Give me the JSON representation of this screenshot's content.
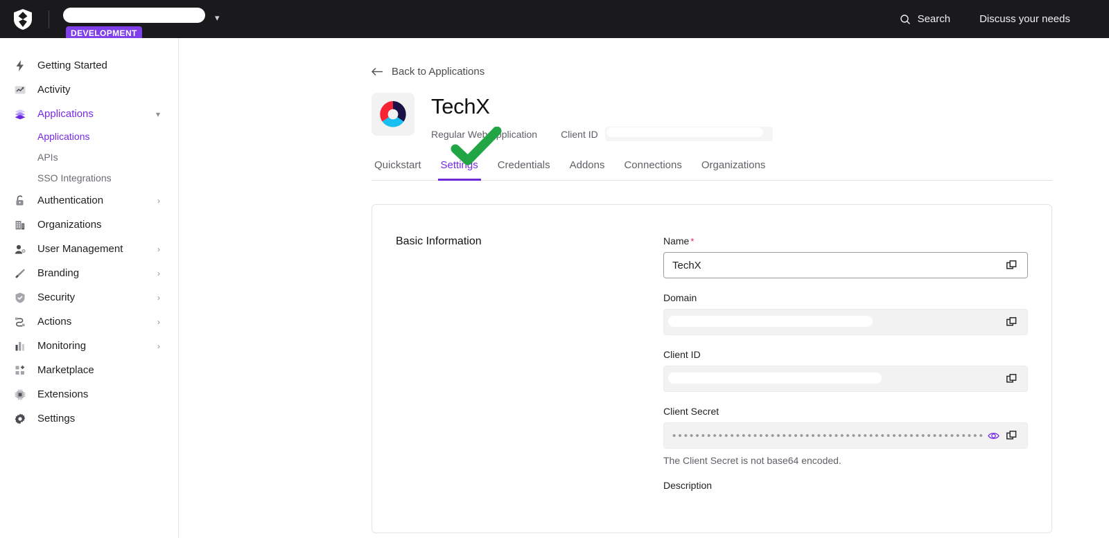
{
  "topbar": {
    "logo_icon": "auth0-shield-logo",
    "tenant_name_redacted": true,
    "environment_badge": "DEVELOPMENT",
    "tenant_chevron_icon": "chevron-down-icon",
    "search_icon": "search-icon",
    "search_label": "Search",
    "discuss_label": "Discuss your needs",
    "bg_color": "#1a1a1c",
    "badge_color": "#7f3fea"
  },
  "sidebar": {
    "accent_color": "#7629e8",
    "items": [
      {
        "label": "Getting Started",
        "icon": "lightning-bolt-icon",
        "active": false,
        "caret": ""
      },
      {
        "label": "Activity",
        "icon": "activity-chart-icon",
        "active": false,
        "caret": ""
      },
      {
        "label": "Applications",
        "icon": "layers-stack-icon",
        "active": true,
        "caret": "chevron-down-icon"
      },
      {
        "label": "Authentication",
        "icon": "lock-icon",
        "active": false,
        "caret": "chevron-right-icon"
      },
      {
        "label": "Organizations",
        "icon": "building-icon",
        "active": false,
        "caret": ""
      },
      {
        "label": "User Management",
        "icon": "user-gear-icon",
        "active": false,
        "caret": "chevron-right-icon"
      },
      {
        "label": "Branding",
        "icon": "paintbrush-icon",
        "active": false,
        "caret": "chevron-right-icon"
      },
      {
        "label": "Security",
        "icon": "shield-check-icon",
        "active": false,
        "caret": "chevron-right-icon"
      },
      {
        "label": "Actions",
        "icon": "actions-flow-icon",
        "active": false,
        "caret": "chevron-right-icon"
      },
      {
        "label": "Monitoring",
        "icon": "bar-chart-icon",
        "active": false,
        "caret": "chevron-right-icon"
      },
      {
        "label": "Marketplace",
        "icon": "grid-plus-icon",
        "active": false,
        "caret": ""
      },
      {
        "label": "Extensions",
        "icon": "chip-icon",
        "active": false,
        "caret": ""
      },
      {
        "label": "Settings",
        "icon": "gear-icon",
        "active": false,
        "caret": ""
      }
    ],
    "subitems": [
      {
        "label": "Applications",
        "active": true
      },
      {
        "label": "APIs",
        "active": false
      },
      {
        "label": "SSO Integrations",
        "active": false
      }
    ]
  },
  "main": {
    "back_link": "Back to Applications",
    "back_icon": "arrow-left-icon",
    "app_logo_icon": "techx-ring-logo",
    "app_title": "TechX",
    "app_type": "Regular Web Application",
    "client_id_label": "Client ID",
    "client_id_value_redacted": true,
    "tabs": [
      {
        "label": "Quickstart",
        "active": false
      },
      {
        "label": "Settings",
        "active": true
      },
      {
        "label": "Credentials",
        "active": false
      },
      {
        "label": "Addons",
        "active": false
      },
      {
        "label": "Connections",
        "active": false
      },
      {
        "label": "Organizations",
        "active": false
      }
    ],
    "annotation": {
      "type": "green-checkmark",
      "color": "#22a544",
      "over_tab": "Settings"
    }
  },
  "card": {
    "section_title": "Basic Information",
    "fields": [
      {
        "label": "Name",
        "required": true,
        "value": "TechX",
        "state": "enabled",
        "redacted": false,
        "copy_icon": "copy-icon",
        "eye_icon": "",
        "helper": ""
      },
      {
        "label": "Domain",
        "required": false,
        "value": "",
        "state": "disabled",
        "redacted": true,
        "copy_icon": "copy-icon",
        "eye_icon": "",
        "helper": ""
      },
      {
        "label": "Client ID",
        "required": false,
        "value": "",
        "state": "disabled",
        "redacted": true,
        "copy_icon": "copy-icon",
        "eye_icon": "",
        "helper": ""
      },
      {
        "label": "Client Secret",
        "required": false,
        "value": "••••••••••••••••••••••••••••••••••••••••••••••••••••••••••••••••••••",
        "state": "disabled",
        "redacted": false,
        "copy_icon": "copy-icon",
        "eye_icon": "eye-icon",
        "helper": "The Client Secret is not base64 encoded."
      },
      {
        "label": "Description",
        "required": false,
        "value": "",
        "state": "cut-off",
        "redacted": false,
        "copy_icon": "",
        "eye_icon": "",
        "helper": ""
      }
    ]
  }
}
